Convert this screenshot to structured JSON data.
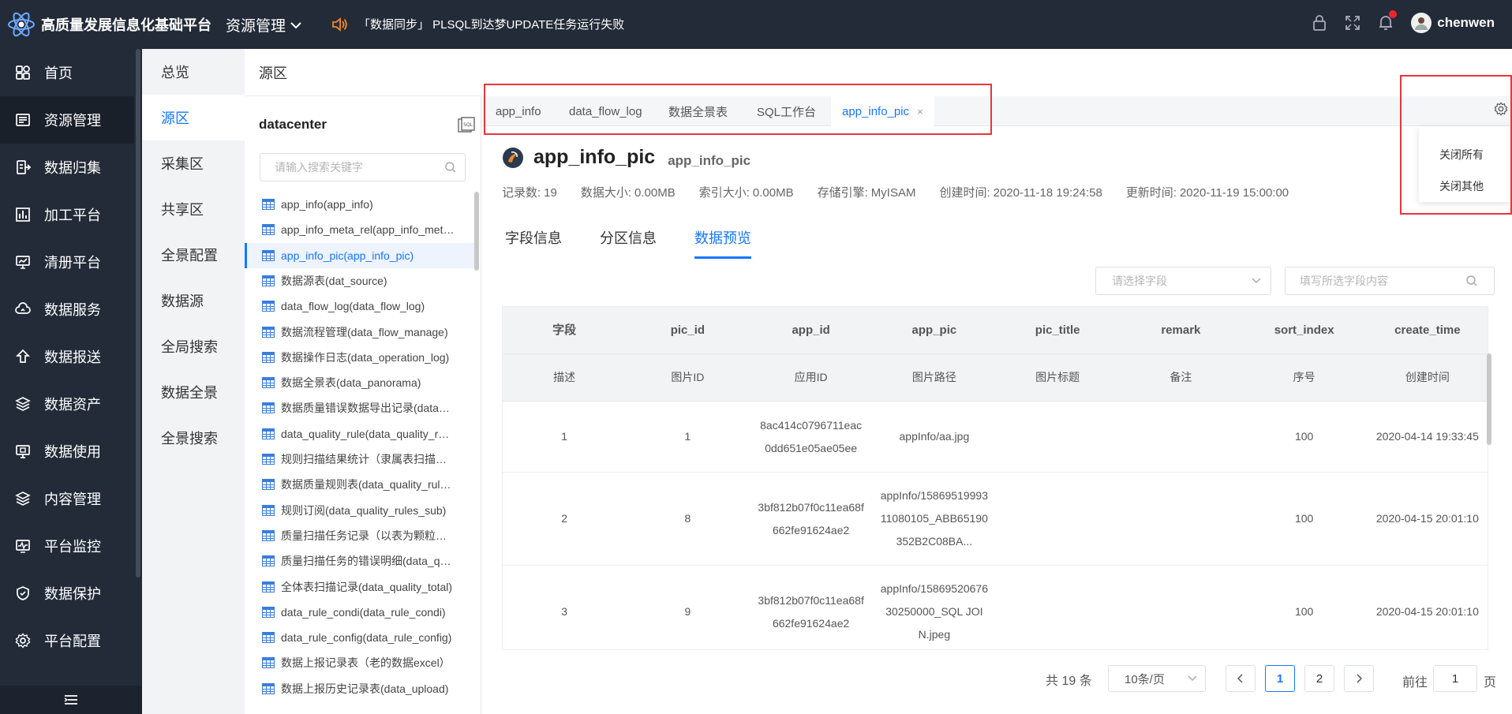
{
  "header": {
    "app_title": "高质量发展信息化基础平台",
    "menu_label": "资源管理",
    "notice": "「数据同步」 PLSQL到达梦UPDATE任务运行失败",
    "username": "chenwen"
  },
  "sidebar": {
    "items": [
      {
        "label": "首页",
        "icon": "dashboard-icon"
      },
      {
        "label": "资源管理",
        "icon": "list-icon"
      },
      {
        "label": "数据归集",
        "icon": "collect-icon"
      },
      {
        "label": "加工平台",
        "icon": "chart-icon"
      },
      {
        "label": "清册平台",
        "icon": "monitor-icon"
      },
      {
        "label": "数据服务",
        "icon": "cloud-icon"
      },
      {
        "label": "数据报送",
        "icon": "upload-icon"
      },
      {
        "label": "数据资产",
        "icon": "layers-icon"
      },
      {
        "label": "数据使用",
        "icon": "display-icon"
      },
      {
        "label": "内容管理",
        "icon": "stack-icon"
      },
      {
        "label": "平台监控",
        "icon": "pulse-icon"
      },
      {
        "label": "数据保护",
        "icon": "shield-icon"
      },
      {
        "label": "平台配置",
        "icon": "gear-icon"
      }
    ]
  },
  "subnav": {
    "items": [
      "总览",
      "源区",
      "采集区",
      "共享区",
      "全景配置",
      "数据源",
      "全局搜索",
      "数据全景",
      "全景搜索"
    ]
  },
  "breadcrumb": "源区",
  "tree": {
    "title": "datacenter",
    "search_placeholder": "请输入搜索关键字",
    "items": [
      "app_info(app_info)",
      "app_info_meta_rel(app_info_meta_rel)",
      "app_info_pic(app_info_pic)",
      "数据源表(dat_source)",
      "data_flow_log(data_flow_log)",
      "数据流程管理(data_flow_manage)",
      "数据操作日志(data_operation_log)",
      "数据全景表(data_panorama)",
      "数据质量错误数据导出记录(data_quality)",
      "data_quality_rule(data_quality_rule)",
      "规则扫描结果统计（隶属表扫描结果）",
      "数据质量规则表(data_quality_rules)",
      "规则订阅(data_quality_rules_sub)",
      "质量扫描任务记录（以表为颗粒度）",
      "质量扫描任务的错误明细(data_quality)",
      "全体表扫描记录(data_quality_total)",
      "data_rule_condi(data_rule_condi)",
      "data_rule_config(data_rule_config)",
      "数据上报记录表（老的数据excel）",
      "数据上报历史记录表(data_upload)"
    ]
  },
  "tabs": [
    {
      "label": "app_info"
    },
    {
      "label": "data_flow_log"
    },
    {
      "label": "数据全景表"
    },
    {
      "label": "SQL工作台"
    },
    {
      "label": "app_info_pic",
      "close": "×"
    }
  ],
  "tab_menu": {
    "close_all": "关闭所有",
    "close_others": "关闭其他"
  },
  "detail": {
    "title": "app_info_pic",
    "subtitle": "app_info_pic",
    "meta": [
      {
        "label": "记录数:",
        "value": "19"
      },
      {
        "label": "数据大小:",
        "value": "0.00MB"
      },
      {
        "label": "索引大小:",
        "value": "0.00MB"
      },
      {
        "label": "存储引擎:",
        "value": "MyISAM"
      },
      {
        "label": "创建时间:",
        "value": "2020-11-18 19:24:58"
      },
      {
        "label": "更新时间:",
        "value": "2020-11-19 15:00:00"
      }
    ],
    "subtabs": [
      "字段信息",
      "分区信息",
      "数据预览"
    ],
    "field_select_placeholder": "请选择字段",
    "field_filter_placeholder": "填写所选字段内容"
  },
  "table": {
    "header_fields": [
      "字段",
      "pic_id",
      "app_id",
      "app_pic",
      "pic_title",
      "remark",
      "sort_index",
      "create_time"
    ],
    "header_desc": [
      "描述",
      "图片ID",
      "应用ID",
      "图片路径",
      "图片标题",
      "备注",
      "序号",
      "创建时间"
    ],
    "rows": [
      [
        "1",
        "1",
        "8ac414c0796711eac0dd651e05ae05ee",
        "appInfo/aa.jpg",
        "",
        "",
        "100",
        "2020-04-14 19:33:45"
      ],
      [
        "2",
        "8",
        "3bf812b07f0c11ea68f662fe91624ae2",
        "appInfo/1586951999311080105_ABB65190352B2C08BA...",
        "",
        "",
        "100",
        "2020-04-15 20:01:10"
      ],
      [
        "3",
        "9",
        "3bf812b07f0c11ea68f662fe91624ae2",
        "appInfo/1586952067630250000_SQL JOIN.jpeg",
        "",
        "",
        "100",
        "2020-04-15 20:01:10"
      ]
    ]
  },
  "pagination": {
    "total": "共 19 条",
    "page_size": "10条/页",
    "pages": [
      "1",
      "2"
    ],
    "current_page": "1",
    "goto_label": "前往",
    "goto_value": "1",
    "goto_unit": "页"
  },
  "colors": {
    "topbar": "#232b38",
    "accent": "#1677ff",
    "highlight_box": "#e8363a"
  }
}
